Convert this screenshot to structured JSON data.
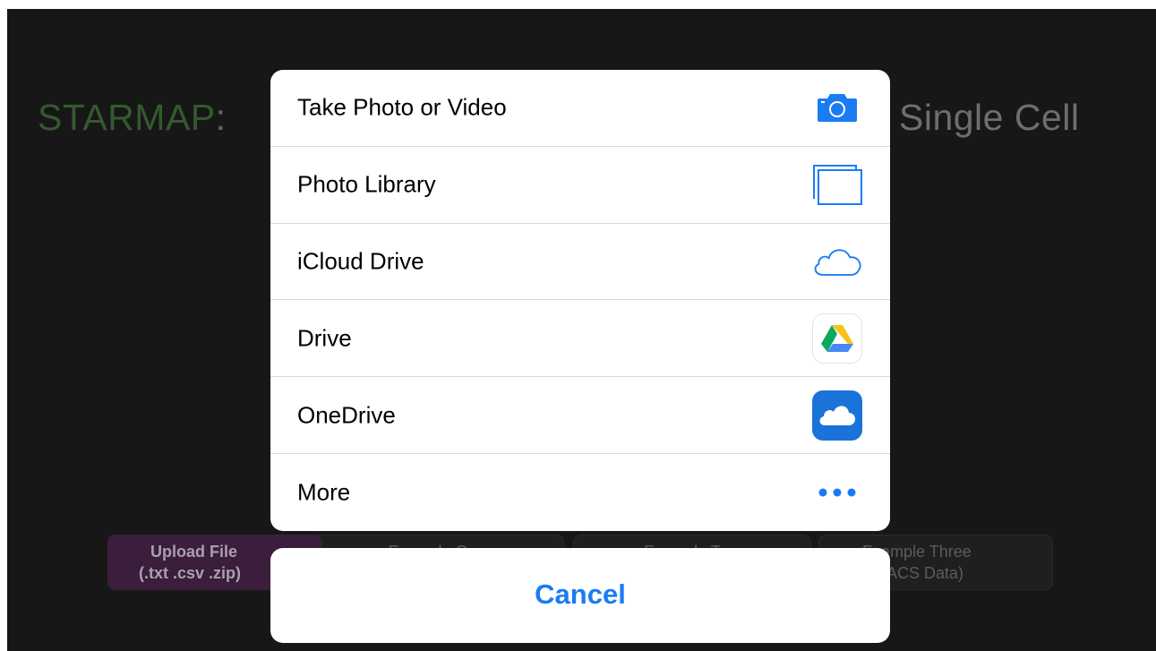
{
  "background": {
    "title_left": "STARMAP",
    "title_colon": ":",
    "title_right": "Single Cell",
    "buttons": [
      {
        "line1": "Upload File",
        "line2": "(.txt .csv .zip)"
      },
      {
        "line1": "Example One",
        "line2": ""
      },
      {
        "line1": "Example Two",
        "line2": ""
      },
      {
        "line1": "Example Three",
        "line2": "K FACS Data)"
      }
    ]
  },
  "action_sheet": {
    "items": [
      {
        "label": "Take Photo or Video",
        "icon": "camera-icon"
      },
      {
        "label": "Photo Library",
        "icon": "photo-library-icon"
      },
      {
        "label": "iCloud Drive",
        "icon": "icloud-drive-icon"
      },
      {
        "label": "Drive",
        "icon": "google-drive-icon"
      },
      {
        "label": "OneDrive",
        "icon": "onedrive-icon"
      },
      {
        "label": "More",
        "icon": "more-icon"
      }
    ],
    "cancel_label": "Cancel"
  },
  "colors": {
    "accent": "#1a7cf3",
    "overlay": "#171717",
    "upload_button": "#3a1e3b",
    "title_green": "#35592f"
  }
}
